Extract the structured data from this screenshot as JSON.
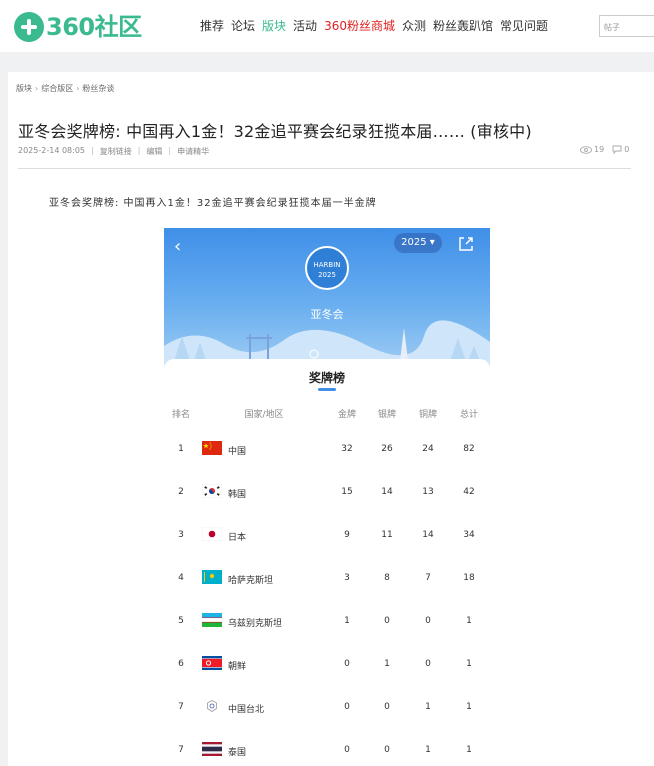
{
  "header": {
    "logo_text": "360社区",
    "nav": [
      {
        "label": "推荐",
        "style": "normal"
      },
      {
        "label": "论坛",
        "style": "normal"
      },
      {
        "label": "版块",
        "style": "active"
      },
      {
        "label": "活动",
        "style": "normal"
      },
      {
        "label": "360粉丝商城",
        "style": "red"
      },
      {
        "label": "众测",
        "style": "normal"
      },
      {
        "label": "粉丝轰趴馆",
        "style": "normal"
      },
      {
        "label": "常见问题",
        "style": "normal"
      }
    ],
    "search_placeholder": "帖子"
  },
  "breadcrumb": [
    "版块",
    "综合版区",
    "粉丝杂谈"
  ],
  "post": {
    "title": "亚冬会奖牌榜: 中国再入1金！32金追平赛会纪录狂揽本届…… (审核中)",
    "date": "2025-2-14 08:05",
    "actions": [
      "复制链接",
      "编辑",
      "申请精华"
    ],
    "views": "19",
    "comments": "0",
    "lead": "亚冬会奖牌榜: 中国再入1金！32金追平赛会纪录狂揽本届一半金牌"
  },
  "embedded": {
    "year": "2025",
    "badge_line1": "HARBIN",
    "badge_line2": "2025",
    "hero_label": "亚冬会",
    "panel_title": "奖牌榜",
    "columns": {
      "rank": "排名",
      "country": "国家/地区",
      "gold": "金牌",
      "silver": "银牌",
      "bronze": "铜牌",
      "total": "总计"
    },
    "rows": [
      {
        "rank": "1",
        "country": "中国",
        "gold": "32",
        "silver": "26",
        "bronze": "24",
        "total": "82",
        "flag": "cn-flag"
      },
      {
        "rank": "2",
        "country": "韩国",
        "gold": "15",
        "silver": "14",
        "bronze": "13",
        "total": "42",
        "flag": "kr-flag"
      },
      {
        "rank": "3",
        "country": "日本",
        "gold": "9",
        "silver": "11",
        "bronze": "14",
        "total": "34",
        "flag": "jp-flag"
      },
      {
        "rank": "4",
        "country": "哈萨克斯坦",
        "gold": "3",
        "silver": "8",
        "bronze": "7",
        "total": "18",
        "flag": "kz-flag"
      },
      {
        "rank": "5",
        "country": "乌兹别克斯坦",
        "gold": "1",
        "silver": "0",
        "bronze": "0",
        "total": "1",
        "flag": "uz-flag"
      },
      {
        "rank": "6",
        "country": "朝鲜",
        "gold": "0",
        "silver": "1",
        "bronze": "0",
        "total": "1",
        "flag": "kp-flag"
      },
      {
        "rank": "7",
        "country": "中国台北",
        "gold": "0",
        "silver": "0",
        "bronze": "1",
        "total": "1",
        "flag": "tpe-flag"
      },
      {
        "rank": "7",
        "country": "泰国",
        "gold": "0",
        "silver": "0",
        "bronze": "1",
        "total": "1",
        "flag": "th-flag"
      }
    ]
  },
  "colors": {
    "brand": "#3aba8e",
    "accent_red": "#e02020",
    "hero_blue": "#3f8fe8"
  }
}
